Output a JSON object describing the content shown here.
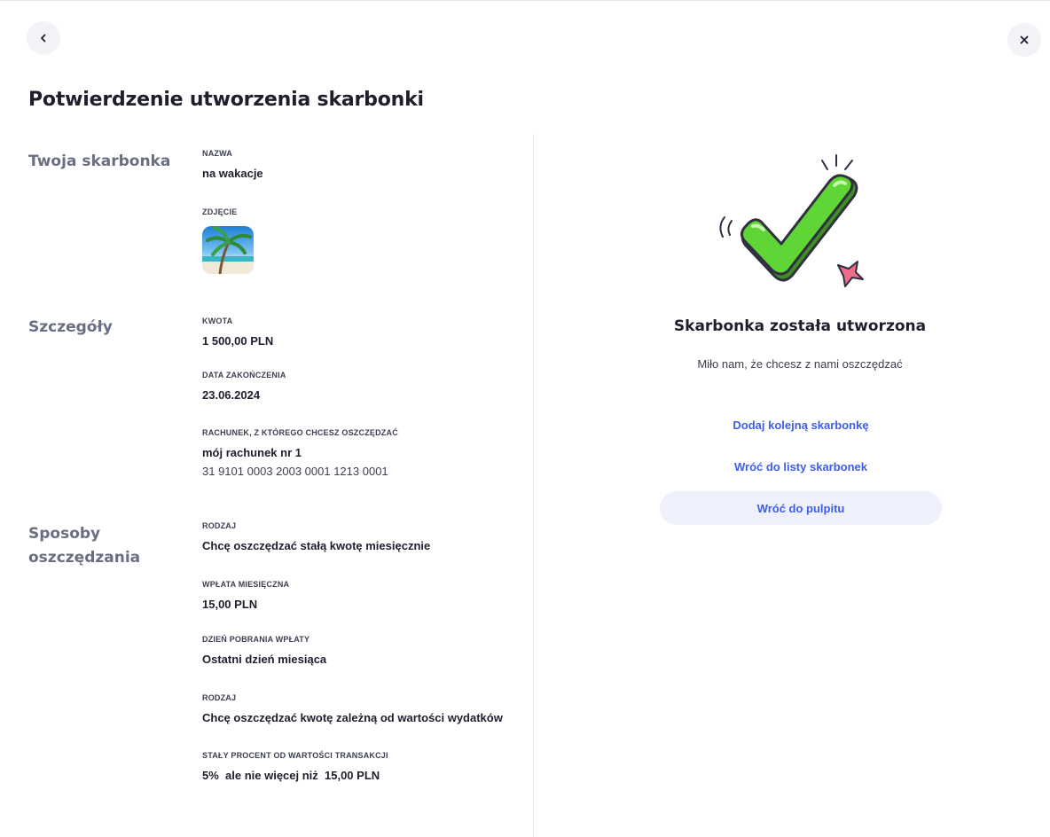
{
  "header": {
    "back_icon": "chevron-left-icon",
    "close_icon": "close-icon",
    "title": "Potwierdzenie utworzenia skarbonki"
  },
  "sections": {
    "piggy": {
      "heading": "Twoja skarbonka",
      "name_label": "NAZWA",
      "name_value": "na wakacje",
      "photo_label": "ZDJĘCIE"
    },
    "details": {
      "heading": "Szczegóły",
      "amount_label": "KWOTA",
      "amount_value": "1 500,00 PLN",
      "end_date_label": "DATA ZAKOŃCZENIA",
      "end_date_value": "23.06.2024",
      "account_label": "RACHUNEK, Z KTÓREGO CHCESZ OSZCZĘDZAĆ",
      "account_name": "mój rachunek nr 1",
      "account_number": "31 9101 0003 2003 0001 1213 0001"
    },
    "methods": {
      "heading_line1": "Sposoby",
      "heading_line2": "oszczędzania",
      "type1_label": "RODZAJ",
      "type1_value": "Chcę oszczędzać stałą kwotę miesięcznie",
      "monthly_label": "WPŁATA MIESIĘCZNA",
      "monthly_value": "15,00 PLN",
      "day_label": "DZIEŃ POBRANIA WPŁATY",
      "day_value": "Ostatni dzień miesiąca",
      "type2_label": "RODZAJ",
      "type2_value": "Chcę oszczędzać kwotę zależną od wartości wydatków",
      "percent_label": "STAŁY PROCENT OD WARTOŚCI TRANSAKCJI",
      "percent_value": "5%  ale nie więcej niż  15,00 PLN"
    }
  },
  "success": {
    "icon": "checkmark-illustration-icon",
    "title": "Skarbonka została utworzona",
    "subtitle": "Miło nam, że chcesz z nami oszczędzać",
    "add_another": "Dodaj kolejną skarbonkę",
    "back_to_list": "Wróć do listy skarbonek",
    "back_to_dashboard": "Wróć do pulpitu"
  },
  "colors": {
    "accent": "#3f5ee6",
    "check_green": "#5fd636",
    "button_bg": "#eef1fb"
  }
}
